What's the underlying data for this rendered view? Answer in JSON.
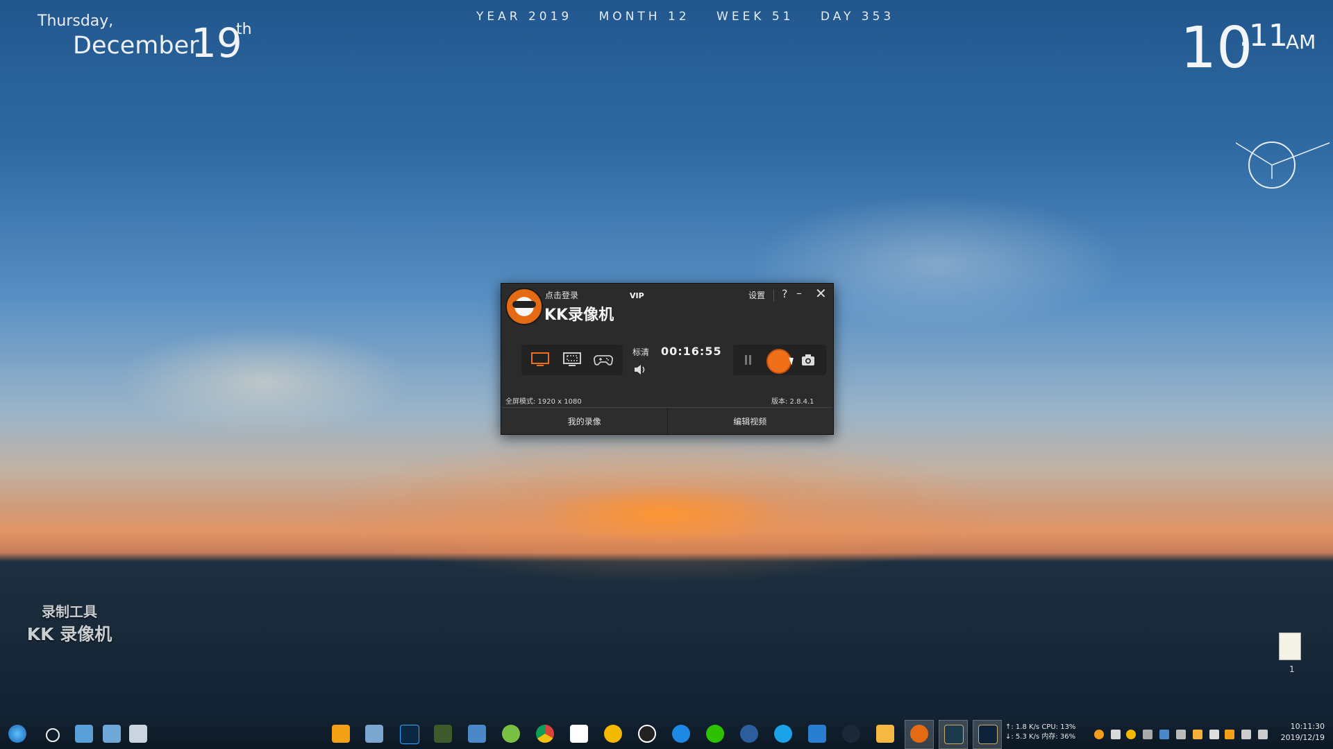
{
  "desktop": {
    "day_of_week": "Thursday,",
    "month": "December",
    "day": "19",
    "day_suffix": "th",
    "year_bar": [
      "YEAR 2019",
      "MONTH 12",
      "WEEK 51",
      "DAY 353"
    ],
    "clock_hour": "10",
    "clock_minute": ":11",
    "clock_ampm": "AM",
    "watermark_line1": "录制工具",
    "watermark_line2": "KK 录像机",
    "file_caption": "1"
  },
  "app": {
    "login_label": "点击登录",
    "vip_label": "VIP",
    "name": "KK录像机",
    "settings_label": "设置",
    "help_label": "?",
    "minimize_label": "–",
    "close_label": "✕",
    "quality_label": "标清",
    "timer": "00:16:55",
    "mode_text": "全屏模式: 1920 x 1080",
    "version_text": "版本: 2.8.4.1",
    "tab_recordings": "我的录像",
    "tab_edit": "编辑视频"
  },
  "taskbar": {
    "net_up": "↑:  1.8 K/s CPU: 13%",
    "net_down": "↓:  5.3 K/s 内存: 36%",
    "time": "10:11:30",
    "date": "2019/12/19"
  },
  "colors": {
    "accent": "#f0701a",
    "window_bg": "#2b2b2b"
  }
}
